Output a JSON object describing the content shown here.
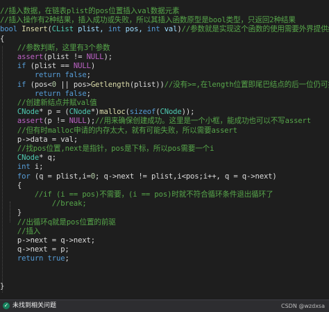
{
  "code_lines": [
    [
      {
        "t": "//插入数据，在链表plist的pos位置插入val数据元素",
        "c": "comment"
      }
    ],
    [
      {
        "t": "//插入操作有2种结果，插入成功或失败，所以其插入函数原型是bool类型，只返回2种结果",
        "c": "comment"
      }
    ],
    [
      {
        "t": "bool ",
        "c": "kw"
      },
      {
        "t": "Insert",
        "c": "fn"
      },
      {
        "t": "(",
        "c": "plain"
      },
      {
        "t": "CList",
        "c": "type"
      },
      {
        "t": " plist, ",
        "c": "param"
      },
      {
        "t": "int",
        "c": "kw"
      },
      {
        "t": " pos, ",
        "c": "param"
      },
      {
        "t": "int",
        "c": "kw"
      },
      {
        "t": " val",
        "c": "param"
      },
      {
        "t": ")",
        "c": "plain"
      },
      {
        "t": "//参数就是实现这个函数的使用需要外界提供给它的数据东西",
        "c": "comment"
      }
    ],
    [
      {
        "t": "{",
        "c": "plain"
      }
    ],
    [
      {
        "t": "    //参数判断，这里有3个参数",
        "c": "comment"
      }
    ],
    [
      {
        "t": "    ",
        "c": "plain"
      },
      {
        "t": "assert",
        "c": "macro"
      },
      {
        "t": "(plist != ",
        "c": "plain"
      },
      {
        "t": "NULL",
        "c": "macro"
      },
      {
        "t": ");",
        "c": "plain"
      }
    ],
    [
      {
        "t": "    ",
        "c": "plain"
      },
      {
        "t": "if",
        "c": "kw"
      },
      {
        "t": " (plist == ",
        "c": "plain"
      },
      {
        "t": "NULL",
        "c": "macro"
      },
      {
        "t": ")",
        "c": "plain"
      }
    ],
    [
      {
        "t": "        ",
        "c": "plain"
      },
      {
        "t": "return",
        "c": "kw"
      },
      {
        "t": " ",
        "c": "plain"
      },
      {
        "t": "false",
        "c": "kw"
      },
      {
        "t": ";",
        "c": "plain"
      }
    ],
    [
      {
        "t": "    ",
        "c": "plain"
      },
      {
        "t": "if",
        "c": "kw"
      },
      {
        "t": " (pos<",
        "c": "plain"
      },
      {
        "t": "0",
        "c": "num"
      },
      {
        "t": " || pos>",
        "c": "plain"
      },
      {
        "t": "Getlength",
        "c": "fn"
      },
      {
        "t": "(plist))",
        "c": "plain"
      },
      {
        "t": "//没有>=,在length位置即尾巴结点的后一位仍可插入",
        "c": "comment"
      }
    ],
    [
      {
        "t": "        ",
        "c": "plain"
      },
      {
        "t": "return",
        "c": "kw"
      },
      {
        "t": " ",
        "c": "plain"
      },
      {
        "t": "false",
        "c": "kw"
      },
      {
        "t": ";",
        "c": "plain"
      }
    ],
    [
      {
        "t": "    //创建新结点并赋val值",
        "c": "comment"
      }
    ],
    [
      {
        "t": "    ",
        "c": "plain"
      },
      {
        "t": "CNode",
        "c": "type"
      },
      {
        "t": "* p = (",
        "c": "plain"
      },
      {
        "t": "CNode",
        "c": "type"
      },
      {
        "t": "*)",
        "c": "plain"
      },
      {
        "t": "malloc",
        "c": "fn"
      },
      {
        "t": "(",
        "c": "plain"
      },
      {
        "t": "sizeof",
        "c": "kw"
      },
      {
        "t": "(",
        "c": "plain"
      },
      {
        "t": "CNode",
        "c": "type"
      },
      {
        "t": "));",
        "c": "plain"
      }
    ],
    [
      {
        "t": "    ",
        "c": "plain"
      },
      {
        "t": "assert",
        "c": "macro"
      },
      {
        "t": "(p != ",
        "c": "plain"
      },
      {
        "t": "NULL",
        "c": "macro"
      },
      {
        "t": ");",
        "c": "plain"
      },
      {
        "t": "//用来确保创建成功。这里是一个小框，能成功也可以不写assert",
        "c": "comment"
      }
    ],
    [
      {
        "t": "    //但有时malloc申请的内存太大，就有可能失败，所以需要assert",
        "c": "comment"
      }
    ],
    [
      {
        "t": "    p->data = val;",
        "c": "plain"
      }
    ],
    [
      {
        "t": "    //找pos位置,next是指针，pos是下标，所以pos需要一个i",
        "c": "comment"
      }
    ],
    [
      {
        "t": "    ",
        "c": "plain"
      },
      {
        "t": "CNode",
        "c": "type"
      },
      {
        "t": "* q;",
        "c": "plain"
      }
    ],
    [
      {
        "t": "    ",
        "c": "plain"
      },
      {
        "t": "int",
        "c": "kw"
      },
      {
        "t": " i;",
        "c": "plain"
      }
    ],
    [
      {
        "t": "    ",
        "c": "plain"
      },
      {
        "t": "for",
        "c": "kw"
      },
      {
        "t": " (q = plist,i=",
        "c": "plain"
      },
      {
        "t": "0",
        "c": "num"
      },
      {
        "t": "; q->next != plist,i<pos;i++, q = q->next)",
        "c": "plain"
      }
    ],
    [
      {
        "t": "    {",
        "c": "plain"
      }
    ],
    [
      {
        "t": "        //if (i == pos)不需要，(i == pos)时就不符合循环条件退出循环了",
        "c": "comment"
      }
    ],
    [
      {
        "t": "            //break;",
        "c": "comment"
      }
    ],
    [
      {
        "t": "    }",
        "c": "plain"
      }
    ],
    [
      {
        "t": "    //出循环q就是pos位置的前驱",
        "c": "comment"
      }
    ],
    [
      {
        "t": "    //插入",
        "c": "comment"
      }
    ],
    [
      {
        "t": "    p->next = q->next;",
        "c": "plain"
      }
    ],
    [
      {
        "t": "    q->next = p;",
        "c": "plain"
      }
    ],
    [
      {
        "t": "    ",
        "c": "plain"
      },
      {
        "t": "return",
        "c": "kw"
      },
      {
        "t": " ",
        "c": "plain"
      },
      {
        "t": "true",
        "c": "kw"
      },
      {
        "t": ";",
        "c": "plain"
      }
    ],
    [],
    [],
    [
      {
        "t": "}",
        "c": "plain"
      }
    ]
  ],
  "statusbar": {
    "check_icon": "check-circle-icon",
    "message": "未找到相关问题",
    "watermark": "CSDN @wzdxsa"
  }
}
